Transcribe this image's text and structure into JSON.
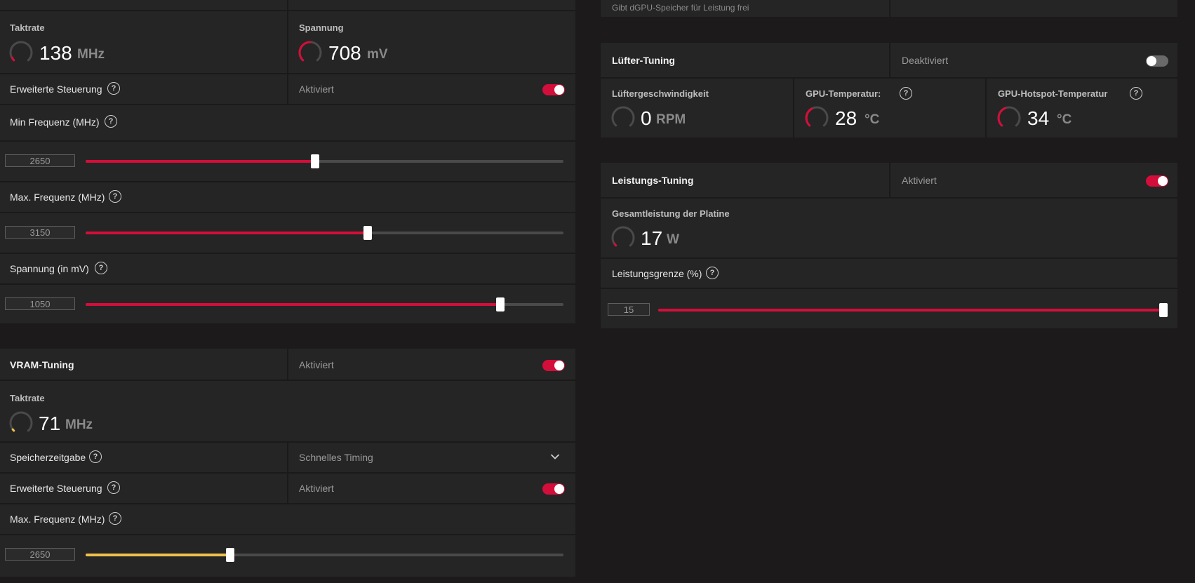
{
  "gpu": {
    "clock_label": "Taktrate",
    "clock_value": "138",
    "clock_unit": "MHz",
    "voltage_label": "Spannung",
    "voltage_value": "708",
    "voltage_unit": "mV",
    "advanced_label": "Erweiterte Steuerung",
    "advanced_state": "Aktiviert",
    "min_freq": {
      "label": "Min Frequenz (MHz)",
      "value": "2650",
      "fraction": 0.48
    },
    "max_freq": {
      "label": "Max. Frequenz (MHz)",
      "value": "3150",
      "fraction": 0.59
    },
    "voltage_mv": {
      "label": "Spannung (in mV)",
      "value": "1050",
      "fraction": 0.868
    }
  },
  "top_right_snippet": "Gibt dGPU-Speicher für Leistung frei",
  "vram": {
    "title": "VRAM-Tuning",
    "state": "Aktiviert",
    "clock_label": "Taktrate",
    "clock_value": "71",
    "clock_unit": "MHz",
    "timing_label": "Speicherzeitgabe",
    "timing_value": "Schnelles Timing",
    "advanced_label": "Erweiterte Steuerung",
    "advanced_state": "Aktiviert",
    "max_freq": {
      "label": "Max. Frequenz (MHz)",
      "value": "2650",
      "fraction": 0.303
    }
  },
  "fan": {
    "title": "Lüfter-Tuning",
    "state": "Deaktiviert",
    "speed_label": "Lüftergeschwindigkeit",
    "speed_value": "0",
    "speed_unit": "RPM",
    "gpu_temp_label": "GPU-Temperatur:",
    "gpu_temp_value": "28",
    "gpu_temp_unit": "°C",
    "hotspot_label": "GPU-Hotspot-Temperatur",
    "hotspot_value": "34",
    "hotspot_unit": "°C"
  },
  "power": {
    "title": "Leistungs-Tuning",
    "state": "Aktiviert",
    "board_label": "Gesamtleistung der Platine",
    "board_value": "17",
    "board_unit": "W",
    "limit": {
      "label": "Leistungsgrenze (%)",
      "value": "15",
      "fraction": 1.0
    }
  },
  "colors": {
    "accent_red": "#d40e3a",
    "accent_yellow": "#f0c14b",
    "panel": "#252526",
    "background": "#1c1a1b"
  },
  "help_glyph": "?",
  "chevron_glyph": "⌄"
}
